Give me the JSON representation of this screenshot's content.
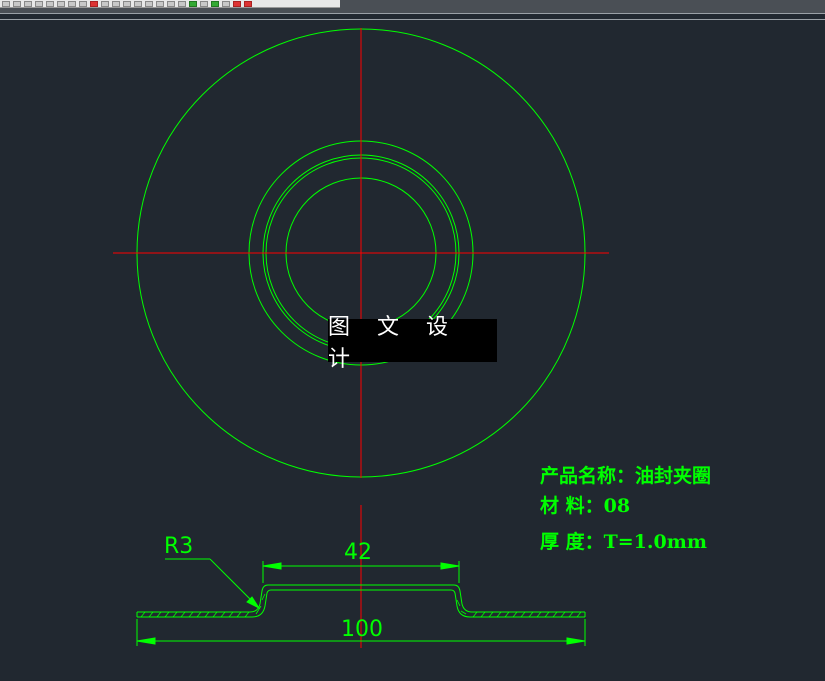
{
  "watermark": "图 文 设 计",
  "info": {
    "product_name": "产品名称：油封夹圈",
    "material": "材    料：08",
    "thickness": "厚    度：T=1.0mm"
  },
  "dimensions": {
    "radius_label": "R3",
    "inner_width": "42",
    "outer_width": "100"
  },
  "colors": {
    "background": "#212830",
    "geometry": "#00ff00",
    "centerline": "#ff0000",
    "dimension": "#00ff00"
  }
}
